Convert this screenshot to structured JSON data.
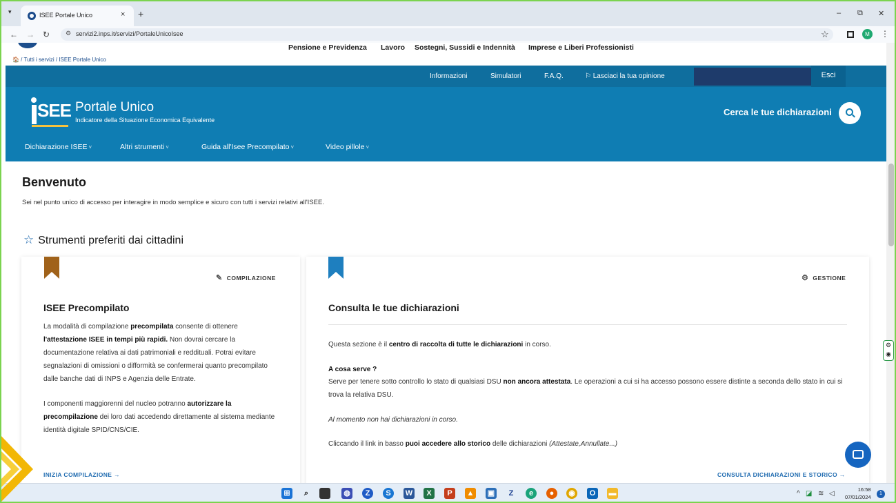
{
  "browser": {
    "tab_title": "ISEE Portale Unico",
    "tab_close": "×",
    "new_tab": "+",
    "url": "servizi2.inps.it/servizi/PortaleUnicoIsee",
    "profile_initial": "M",
    "window_minimize": "–",
    "window_restore": "⧉",
    "window_close": "✕"
  },
  "inps_header": {
    "menu": [
      "Pensione e Previdenza",
      "Lavoro",
      "Sostegni, Sussidi e Indennità",
      "Imprese e Liberi Professionisti"
    ],
    "breadcrumb": "🏠 / Tutti i servizi / ISEE Portale Unico"
  },
  "utility_bar": {
    "items": [
      "Informazioni",
      "Simulatori",
      "F.A.Q.",
      "⚐ Lasciaci la tua opinione"
    ],
    "logout": "Esci"
  },
  "hero": {
    "logo_text": "SEE",
    "title": "Portale Unico",
    "subtitle": "Indicatore della Situazione Economica Equivalente",
    "search_label": "Cerca le tue dichiarazioni",
    "nav": [
      "Dichiarazione ISEE",
      "Altri strumenti",
      "Guida all'Isee Precompilato",
      "Video pillole"
    ]
  },
  "welcome": {
    "title": "Benvenuto",
    "subtitle": "Sei nel punto unico di accesso per interagire in modo semplice e sicuro con tutti i servizi relativi all'ISEE."
  },
  "section": {
    "title": "Strumenti preferiti dai cittadini"
  },
  "card_precompilato": {
    "tag": "COMPILAZIONE",
    "title": "ISEE Precompilato",
    "cta": "INIZIA COMPILAZIONE →"
  },
  "card_consulta": {
    "tag": "GESTIONE",
    "title": "Consulta le tue dichiarazioni",
    "q_title": "A cosa serve ?",
    "no_decl": "Al momento non hai dichiarazioni in corso.",
    "cta": "CONSULTA DICHIARAZIONI E STORICO →"
  },
  "taskbar": {
    "time": "16:58",
    "date": "07/01/2024",
    "notifications": "1"
  },
  "colors": {
    "primary_blue": "#0f7db3",
    "dark_blue": "#0f6e9e",
    "bookmark_brown": "#a0621a",
    "bookmark_blue": "#1e7fbf",
    "link_blue": "#1f6bb0",
    "accent_yellow": "#f6c23e"
  }
}
